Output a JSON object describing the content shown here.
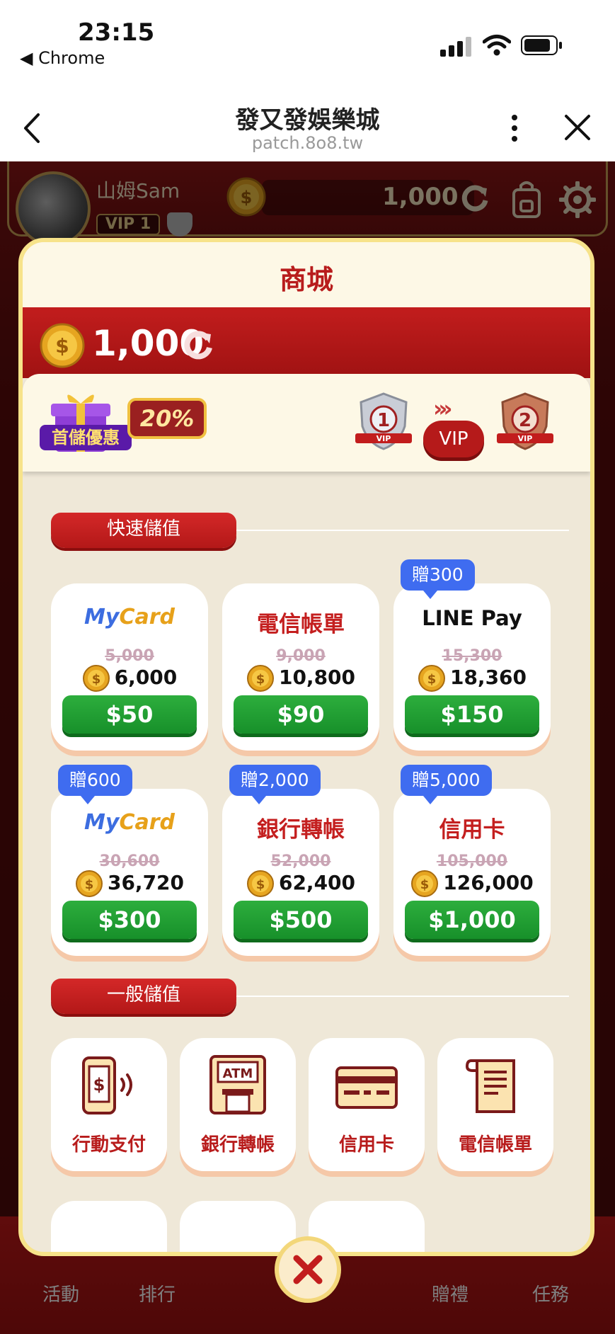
{
  "status_bar": {
    "time": "23:15",
    "back_app": "◀ Chrome"
  },
  "browser": {
    "title": "發又發娛樂城",
    "url": "patch.8o8.tw"
  },
  "player": {
    "name": "山姆Sam",
    "vip": "VIP 1",
    "balance": "1,000"
  },
  "bottom_nav": [
    "活動",
    "排行",
    "贈禮",
    "任務"
  ],
  "shop": {
    "title": "商城",
    "balance": "1,000",
    "promo": {
      "label": "首儲優惠",
      "percent": "20%"
    },
    "vip": {
      "current": "1",
      "next": "2",
      "button": "VIP",
      "arrows": "›››",
      "shield_text": "VIP"
    },
    "quick_section": "快速儲值",
    "quick_cards": [
      {
        "label": "MyCard",
        "old": "5,000",
        "new": "6,000",
        "price": "$50",
        "bonus": ""
      },
      {
        "label": "電信帳單",
        "old": "9,000",
        "new": "10,800",
        "price": "$90",
        "bonus": ""
      },
      {
        "label": "LINE Pay",
        "old": "15,300",
        "new": "18,360",
        "price": "$150",
        "bonus": "贈300"
      },
      {
        "label": "MyCard",
        "old": "30,600",
        "new": "36,720",
        "price": "$300",
        "bonus": "贈600"
      },
      {
        "label": "銀行轉帳",
        "old": "52,000",
        "new": "62,400",
        "price": "$500",
        "bonus": "贈2,000"
      },
      {
        "label": "信用卡",
        "old": "105,000",
        "new": "126,000",
        "price": "$1,000",
        "bonus": "贈5,000"
      }
    ],
    "general_section": "一般儲值",
    "general_methods": [
      {
        "label": "行動支付",
        "icon": "mobile-payment-icon"
      },
      {
        "label": "銀行轉帳",
        "icon": "atm-icon",
        "icon_text": "ATM"
      },
      {
        "label": "信用卡",
        "icon": "credit-card-icon"
      },
      {
        "label": "電信帳單",
        "icon": "bill-scroll-icon"
      }
    ]
  },
  "colors": {
    "brand_red": "#b81c1c",
    "gold": "#f7e38a",
    "green": "#17902a",
    "bonus_blue": "#3f6cf0"
  }
}
